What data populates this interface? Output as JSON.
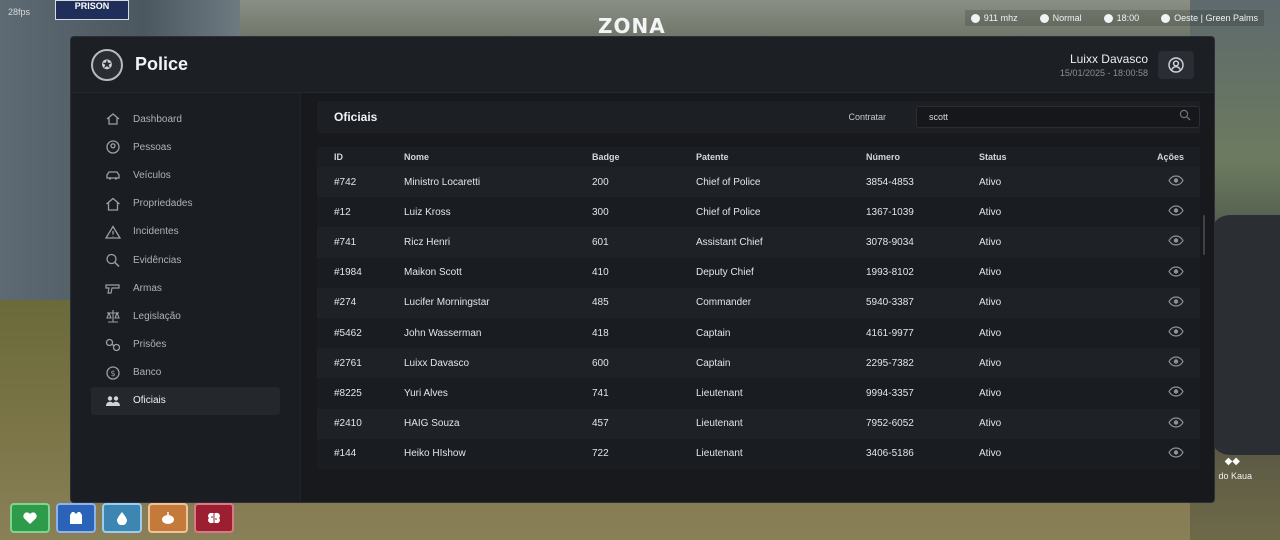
{
  "overlay": {
    "fps": "28fps",
    "sign_text": "PRISON",
    "brand": "ZONA",
    "hud": {
      "radio": "911 mhz",
      "voice": "Normal",
      "time": "18:00",
      "location": "Oeste | Green Palms"
    },
    "nearby_player": "do Kaua"
  },
  "window": {
    "title": "Police",
    "user": {
      "name": "Luixx Davasco",
      "datetime": "15/01/2025 - 18:00:58"
    }
  },
  "sidebar": {
    "items": [
      {
        "label": "Dashboard",
        "icon": "home-icon",
        "active": false
      },
      {
        "label": "Pessoas",
        "icon": "user-circle-icon",
        "active": false
      },
      {
        "label": "Veículos",
        "icon": "car-icon",
        "active": false
      },
      {
        "label": "Propriedades",
        "icon": "house-icon",
        "active": false
      },
      {
        "label": "Incidentes",
        "icon": "warning-icon",
        "active": false
      },
      {
        "label": "Evidências",
        "icon": "magnifier-icon",
        "active": false
      },
      {
        "label": "Armas",
        "icon": "gun-icon",
        "active": false
      },
      {
        "label": "Legislação",
        "icon": "scale-icon",
        "active": false
      },
      {
        "label": "Prisões",
        "icon": "handcuffs-icon",
        "active": false
      },
      {
        "label": "Banco",
        "icon": "dollar-icon",
        "active": false
      },
      {
        "label": "Oficiais",
        "icon": "users-icon",
        "active": true
      }
    ]
  },
  "panel": {
    "title": "Oficiais",
    "hire_label": "Contratar",
    "search": {
      "value": "scott"
    },
    "columns": {
      "id": "ID",
      "nome": "Nome",
      "badge": "Badge",
      "patente": "Patente",
      "numero": "Número",
      "status": "Status",
      "acoes": "Ações"
    },
    "rows": [
      {
        "id": "#742",
        "nome": "Ministro Locaretti",
        "badge": "200",
        "patente": "Chief of Police",
        "numero": "3854-4853",
        "status": "Ativo"
      },
      {
        "id": "#12",
        "nome": "Luiz Kross",
        "badge": "300",
        "patente": "Chief of Police",
        "numero": "1367-1039",
        "status": "Ativo"
      },
      {
        "id": "#741",
        "nome": "Ricz Henri",
        "badge": "601",
        "patente": "Assistant Chief",
        "numero": "3078-9034",
        "status": "Ativo"
      },
      {
        "id": "#1984",
        "nome": "Maikon Scott",
        "badge": "410",
        "patente": "Deputy Chief",
        "numero": "1993-8102",
        "status": "Ativo"
      },
      {
        "id": "#274",
        "nome": "Lucifer Morningstar",
        "badge": "485",
        "patente": "Commander",
        "numero": "5940-3387",
        "status": "Ativo"
      },
      {
        "id": "#5462",
        "nome": "John Wasserman",
        "badge": "418",
        "patente": "Captain",
        "numero": "4161-9977",
        "status": "Ativo"
      },
      {
        "id": "#2761",
        "nome": "Luixx Davasco",
        "badge": "600",
        "patente": "Captain",
        "numero": "2295-7382",
        "status": "Ativo"
      },
      {
        "id": "#8225",
        "nome": "Yuri Alves",
        "badge": "741",
        "patente": "Lieutenant",
        "numero": "9994-3357",
        "status": "Ativo"
      },
      {
        "id": "#2410",
        "nome": "HAIG Souza",
        "badge": "457",
        "patente": "Lieutenant",
        "numero": "7952-6052",
        "status": "Ativo"
      },
      {
        "id": "#144",
        "nome": "Heiko HIshow",
        "badge": "722",
        "patente": "Lieutenant",
        "numero": "3406-5186",
        "status": "Ativo"
      }
    ]
  },
  "status_bar": [
    {
      "name": "health",
      "icon": "heart-icon"
    },
    {
      "name": "armor",
      "icon": "vest-icon"
    },
    {
      "name": "water",
      "icon": "drop-icon"
    },
    {
      "name": "food",
      "icon": "food-icon"
    },
    {
      "name": "stress",
      "icon": "brain-icon"
    }
  ]
}
